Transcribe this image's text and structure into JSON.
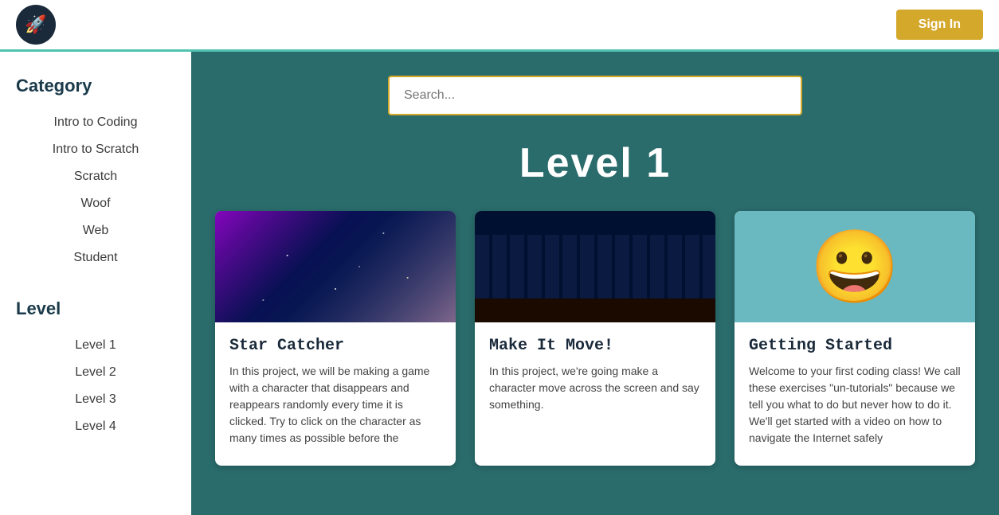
{
  "header": {
    "logo_icon": "🚀",
    "sign_in_label": "Sign In"
  },
  "sidebar": {
    "category_title": "Category",
    "category_items": [
      {
        "label": "Intro to Coding"
      },
      {
        "label": "Intro to Scratch"
      },
      {
        "label": "Scratch"
      },
      {
        "label": "Woof"
      },
      {
        "label": "Web"
      },
      {
        "label": "Student"
      }
    ],
    "level_title": "Level",
    "level_items": [
      {
        "label": "Level 1"
      },
      {
        "label": "Level 2"
      },
      {
        "label": "Level 3"
      },
      {
        "label": "Level 4"
      }
    ]
  },
  "main": {
    "search_placeholder": "Search...",
    "level_heading": "Level  1",
    "cards": [
      {
        "id": "star-catcher",
        "image_type": "galaxy",
        "title": "Star Catcher",
        "description": "In this project, we will be making a game with a character that disappears and reappears randomly every time it is clicked. Try to click on the character as many times as possible before the"
      },
      {
        "id": "make-it-move",
        "image_type": "city",
        "title": "Make It Move!",
        "description": "In this project, we're going make a character move across the screen and say something."
      },
      {
        "id": "getting-started",
        "image_type": "smiley",
        "title": "Getting Started",
        "description": "Welcome to your first coding class! We call these exercises \"un-tutorials\" because we tell you what to do but never how to do it. We'll get started with a video on how to navigate the Internet safely"
      }
    ]
  }
}
